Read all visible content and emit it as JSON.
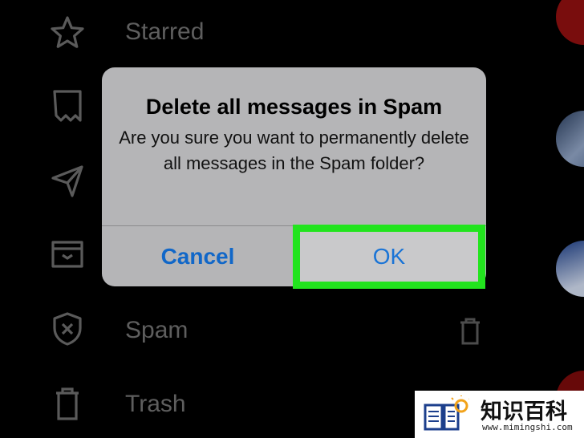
{
  "drawer": {
    "items": [
      {
        "label": "Starred",
        "icon": "star-icon"
      },
      {
        "label": "",
        "icon": "important-icon"
      },
      {
        "label": "",
        "icon": "sent-icon"
      },
      {
        "label": "",
        "icon": "archive-icon"
      },
      {
        "label": "Spam",
        "icon": "spam-shield-icon"
      },
      {
        "label": "Trash",
        "icon": "trash-icon"
      }
    ],
    "spam_action_icon": "trash-icon"
  },
  "dialog": {
    "title": "Delete all messages in Spam",
    "message": "Are you sure you want to permanently delete all messages in the Spam folder?",
    "cancel_label": "Cancel",
    "ok_label": "OK"
  },
  "colors": {
    "background": "#000000",
    "dialog": "#b5b5b7",
    "button_text": "#1167c8",
    "highlight": "#22e41e",
    "drawer_text": "#6f6f6f"
  },
  "watermark": {
    "title": "知识百科",
    "url": "www.mimingshi.com"
  }
}
